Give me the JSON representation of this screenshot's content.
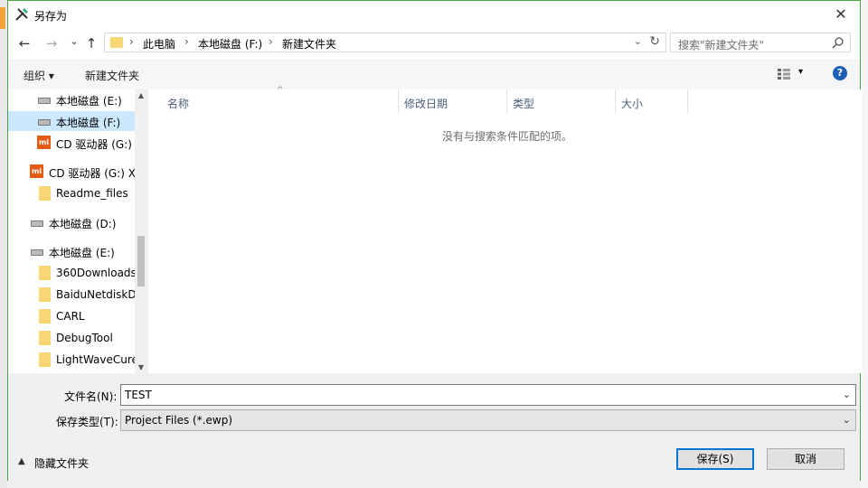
{
  "window": {
    "title": "另存为",
    "close_glyph": "✕"
  },
  "nav": {
    "back_glyph": "←",
    "forward_glyph": "→",
    "recent_glyph": "⌄",
    "up_glyph": "↑",
    "breadcrumb": [
      "此电脑",
      "本地磁盘 (F:)",
      "新建文件夹"
    ],
    "breadcrumb_sep": "›",
    "dropdown_glyph": "⌄",
    "refresh_glyph": "↻"
  },
  "search": {
    "placeholder": "搜索\"新建文件夹\""
  },
  "toolbar": {
    "organize_label": "组织 ▾",
    "new_folder_label": "新建文件夹",
    "view_dropdown_glyph": "▾",
    "help_glyph": "?"
  },
  "tree": {
    "items": [
      {
        "label": "本地磁盘 (E:)",
        "icon": "drive-icon"
      },
      {
        "label": "本地磁盘 (F:)",
        "icon": "drive-icon",
        "selected": true
      },
      {
        "label": "CD 驱动器 (G:) X",
        "icon": "cd-drive-icon"
      },
      {
        "label": "CD 驱动器 (G:) X",
        "icon": "cd-drive-icon"
      },
      {
        "label": "Readme_files",
        "icon": "folder-icon"
      },
      {
        "label": "本地磁盘 (D:)",
        "icon": "drive-icon"
      },
      {
        "label": "本地磁盘 (E:)",
        "icon": "drive-icon"
      },
      {
        "label": "360Downloads",
        "icon": "folder-icon"
      },
      {
        "label": "BaiduNetdiskDownload",
        "icon": "folder-icon"
      },
      {
        "label": "CARL",
        "icon": "folder-icon"
      },
      {
        "label": "DebugTool",
        "icon": "folder-icon"
      },
      {
        "label": "LightWaveCure",
        "icon": "folder-icon"
      }
    ],
    "scroll_up_glyph": "▲",
    "scroll_down_glyph": "▼"
  },
  "file_list": {
    "columns": [
      "名称",
      "修改日期",
      "类型",
      "大小"
    ],
    "sort_glyph": "^",
    "empty_message": "没有与搜索条件匹配的项。"
  },
  "form": {
    "filename_label": "文件名(N):",
    "filename_value": "TEST",
    "filetype_label": "保存类型(T):",
    "filetype_value": "Project Files (*.ewp)",
    "dropdown_glyph": "⌄"
  },
  "footer": {
    "hide_folders_glyph": "▲",
    "hide_folders_label": "隐藏文件夹",
    "save_label": "保存(S)",
    "cancel_label": "取消"
  },
  "colors": {
    "accent": "#0078d7",
    "selection": "#cce8ff",
    "folder": "#f7d774",
    "cd_icon": "#e45b14",
    "border": "#4aa24a"
  }
}
